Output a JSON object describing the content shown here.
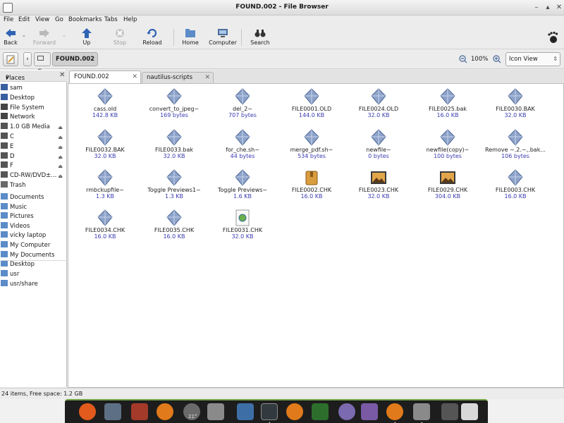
{
  "window": {
    "title": "FOUND.002 - File Browser"
  },
  "menu": [
    "File",
    "Edit",
    "View",
    "Go",
    "Bookmarks",
    "Tabs",
    "Help"
  ],
  "toolbar": {
    "back": "Back",
    "forward": "Forward",
    "up": "Up",
    "stop": "Stop",
    "reload": "Reload",
    "home": "Home",
    "computer": "Computer",
    "search": "Search"
  },
  "location": {
    "drive": "C",
    "folder": "FOUND.002",
    "zoom": "100%",
    "view": "Icon View"
  },
  "sidebar": {
    "header": "Places",
    "items": [
      {
        "label": "sam",
        "icon": "home-icon"
      },
      {
        "label": "Desktop",
        "icon": "desktop-icon"
      },
      {
        "label": "File System",
        "icon": "filesystem-icon"
      },
      {
        "label": "Network",
        "icon": "network-icon"
      },
      {
        "label": "1.0 GB Media",
        "icon": "drive-icon"
      },
      {
        "label": "C",
        "icon": "drive-icon"
      },
      {
        "label": "E",
        "icon": "drive-icon"
      },
      {
        "label": "D",
        "icon": "drive-icon"
      },
      {
        "label": "F",
        "icon": "drive-icon"
      },
      {
        "label": "CD-RW/DVD±...",
        "icon": "optical-drive-icon"
      },
      {
        "label": "Trash",
        "icon": "trash-icon"
      },
      {
        "label": "Documents",
        "icon": "folder-icon"
      },
      {
        "label": "Music",
        "icon": "folder-icon"
      },
      {
        "label": "Pictures",
        "icon": "folder-icon"
      },
      {
        "label": "Videos",
        "icon": "folder-icon"
      },
      {
        "label": "vicky laptop",
        "icon": "folder-icon"
      },
      {
        "label": "My Computer",
        "icon": "folder-icon"
      },
      {
        "label": "My Documents",
        "icon": "folder-icon"
      },
      {
        "label": "Desktop",
        "icon": "folder-icon"
      },
      {
        "label": "usr",
        "icon": "folder-icon"
      },
      {
        "label": "usr/share",
        "icon": "folder-icon"
      }
    ]
  },
  "tabs": [
    {
      "label": "FOUND.002"
    },
    {
      "label": "nautilus-scripts"
    }
  ],
  "files": [
    {
      "name": "cass.old",
      "size": "142.8 KB",
      "icon": "generic-file-icon"
    },
    {
      "name": "convert_to_jpeg~",
      "size": "169 bytes",
      "icon": "generic-file-icon"
    },
    {
      "name": "del_2~",
      "size": "707 bytes",
      "icon": "generic-file-icon"
    },
    {
      "name": "FILE0001.OLD",
      "size": "144.0 KB",
      "icon": "generic-file-icon"
    },
    {
      "name": "FILE0024.OLD",
      "size": "32.0 KB",
      "icon": "generic-file-icon"
    },
    {
      "name": "FILE0025.bak",
      "size": "16.0 KB",
      "icon": "generic-file-icon"
    },
    {
      "name": "FILE0030.BAK",
      "size": "32.0 KB",
      "icon": "generic-file-icon"
    },
    {
      "name": "FILE0032.BAK",
      "size": "32.0 KB",
      "icon": "generic-file-icon"
    },
    {
      "name": "FILE0033.bak",
      "size": "32.0 KB",
      "icon": "generic-file-icon"
    },
    {
      "name": "for_che.sh~",
      "size": "44 bytes",
      "icon": "generic-file-icon"
    },
    {
      "name": "merge_pdf.sh~",
      "size": "534 bytes",
      "icon": "generic-file-icon"
    },
    {
      "name": "newfile~",
      "size": "0 bytes",
      "icon": "generic-file-icon"
    },
    {
      "name": "newfile(copy)~",
      "size": "100 bytes",
      "icon": "generic-file-icon"
    },
    {
      "name": "Remove ~.2.~,.bak...",
      "size": "106 bytes",
      "icon": "generic-file-icon"
    },
    {
      "name": "rmbckupfile~",
      "size": "1.3 KB",
      "icon": "generic-file-icon"
    },
    {
      "name": "Toggle Previews1~",
      "size": "1.3 KB",
      "icon": "generic-file-icon"
    },
    {
      "name": "Toggle Previews~",
      "size": "1.6 KB",
      "icon": "generic-file-icon"
    },
    {
      "name": "FILE0002.CHK",
      "size": "16.0 KB",
      "icon": "archive-file-icon"
    },
    {
      "name": "FILE0023.CHK",
      "size": "32.0 KB",
      "icon": "image-file-icon"
    },
    {
      "name": "FILE0029.CHK",
      "size": "304.0 KB",
      "icon": "image-file-icon"
    },
    {
      "name": "FILE0003.CHK",
      "size": "16.0 KB",
      "icon": "generic-file-icon"
    },
    {
      "name": "FILE0034.CHK",
      "size": "16.0 KB",
      "icon": "generic-file-icon"
    },
    {
      "name": "FILE0035.CHK",
      "size": "16.0 KB",
      "icon": "generic-file-icon"
    },
    {
      "name": "FILE0031.CHK",
      "size": "32.0 KB",
      "icon": "web-document-icon"
    }
  ],
  "status": {
    "text": "24 items, Free space: 1.2 GB"
  },
  "dock": {
    "weather_temp": "21°"
  },
  "colors": {
    "accent": "#3a5fa0",
    "size_text": "#3a3ab0",
    "dock_bg": "#1d1d1d",
    "dock_border": "#77a84a"
  }
}
